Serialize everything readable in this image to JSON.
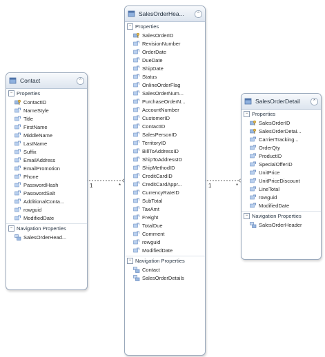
{
  "entities": {
    "contact": {
      "title": "Contact",
      "properties_label": "Properties",
      "properties": [
        {
          "name": "ContactID",
          "key": true
        },
        {
          "name": "NameStyle"
        },
        {
          "name": "Title"
        },
        {
          "name": "FirstName"
        },
        {
          "name": "MiddleName"
        },
        {
          "name": "LastName"
        },
        {
          "name": "Suffix"
        },
        {
          "name": "EmailAddress"
        },
        {
          "name": "EmailPromotion"
        },
        {
          "name": "Phone"
        },
        {
          "name": "PasswordHash"
        },
        {
          "name": "PasswordSalt"
        },
        {
          "name": "AdditionalConta..."
        },
        {
          "name": "rowguid"
        },
        {
          "name": "ModifiedDate"
        }
      ],
      "nav_label": "Navigation Properties",
      "nav": [
        "SalesOrderHead..."
      ]
    },
    "header": {
      "title": "SalesOrderHea...",
      "properties_label": "Properties",
      "properties": [
        {
          "name": "SalesOrderID",
          "key": true
        },
        {
          "name": "RevisionNumber"
        },
        {
          "name": "OrderDate"
        },
        {
          "name": "DueDate"
        },
        {
          "name": "ShipDate"
        },
        {
          "name": "Status"
        },
        {
          "name": "OnlineOrderFlag"
        },
        {
          "name": "SalesOrderNum..."
        },
        {
          "name": "PurchaseOrderN..."
        },
        {
          "name": "AccountNumber"
        },
        {
          "name": "CustomerID"
        },
        {
          "name": "ContactID"
        },
        {
          "name": "SalesPersonID"
        },
        {
          "name": "TerritoryID"
        },
        {
          "name": "BillToAddressID"
        },
        {
          "name": "ShipToAddressID"
        },
        {
          "name": "ShipMethodID"
        },
        {
          "name": "CreditCardID"
        },
        {
          "name": "CreditCardAppr..."
        },
        {
          "name": "CurrencyRateID"
        },
        {
          "name": "SubTotal"
        },
        {
          "name": "TaxAmt"
        },
        {
          "name": "Freight"
        },
        {
          "name": "TotalDue"
        },
        {
          "name": "Comment"
        },
        {
          "name": "rowguid"
        },
        {
          "name": "ModifiedDate"
        }
      ],
      "nav_label": "Navigation Properties",
      "nav": [
        "Contact",
        "SalesOrderDetails"
      ]
    },
    "detail": {
      "title": "SalesOrderDetail",
      "properties_label": "Properties",
      "properties": [
        {
          "name": "SalesOrderID",
          "key": true
        },
        {
          "name": "SalesOrderDetai...",
          "key": true
        },
        {
          "name": "CarrierTracking..."
        },
        {
          "name": "OrderQty"
        },
        {
          "name": "ProductID"
        },
        {
          "name": "SpecialOfferID"
        },
        {
          "name": "UnitPrice"
        },
        {
          "name": "UnitPriceDiscount"
        },
        {
          "name": "LineTotal"
        },
        {
          "name": "rowguid"
        },
        {
          "name": "ModifiedDate"
        }
      ],
      "nav_label": "Navigation Properties",
      "nav": [
        "SalesOrderHeader"
      ]
    }
  },
  "associations": {
    "contact_to_header": {
      "from_mult": "1",
      "to_mult": "*"
    },
    "header_to_detail": {
      "from_mult": "1",
      "to_mult": "*"
    }
  },
  "colors": {
    "key_icon": "#e2b64a",
    "prop_icon": "#6b8fc4",
    "nav_icon": "#5a7fb8",
    "connector": "#666666"
  }
}
